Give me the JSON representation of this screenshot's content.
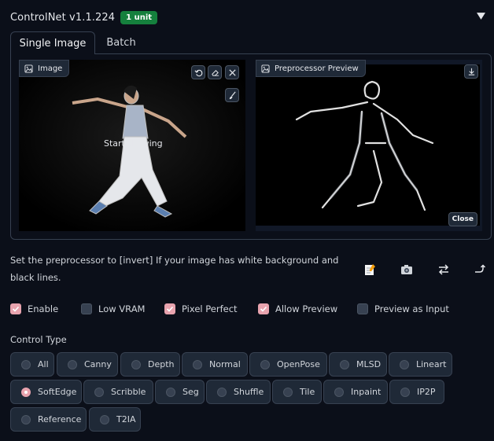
{
  "header": {
    "title": "ControlNet v1.1.224",
    "badge": "1 unit"
  },
  "tabs": [
    {
      "label": "Single Image",
      "active": true
    },
    {
      "label": "Batch",
      "active": false
    }
  ],
  "image_pane": {
    "label": "Image",
    "overlay_text": "Start drawing"
  },
  "preview_pane": {
    "label": "Preprocessor Preview",
    "close_label": "Close"
  },
  "hint": "Set the preprocessor to [invert] If your image has white background and black lines.",
  "checkboxes": [
    {
      "label": "Enable",
      "checked": true
    },
    {
      "label": "Low VRAM",
      "checked": false
    },
    {
      "label": "Pixel Perfect",
      "checked": true
    },
    {
      "label": "Allow Preview",
      "checked": true
    },
    {
      "label": "Preview as Input",
      "checked": false
    }
  ],
  "control_type": {
    "label": "Control Type",
    "selected": "SoftEdge",
    "options": [
      "All",
      "Canny",
      "Depth",
      "Normal",
      "OpenPose",
      "MLSD",
      "Lineart",
      "SoftEdge",
      "Scribble",
      "Seg",
      "Shuffle",
      "Tile",
      "Inpaint",
      "IP2P",
      "Reference",
      "T2IA"
    ]
  },
  "colors": {
    "accent": "#e8a3ae",
    "badge": "#15803d",
    "background": "#0b0f19"
  }
}
